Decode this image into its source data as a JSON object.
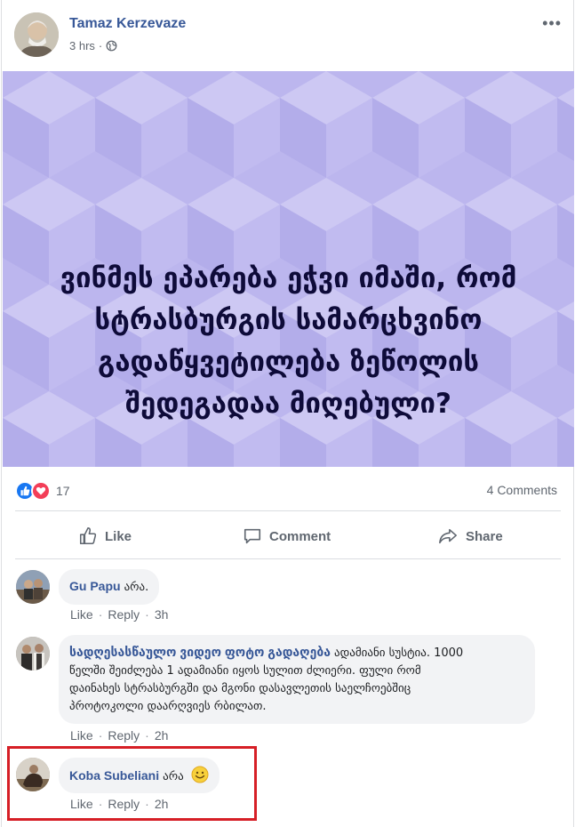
{
  "post": {
    "author": "Tamaz Kerzevaze",
    "time": "3 hrs",
    "privacy_icon": "globe-icon",
    "more_label": "•••",
    "image_text_lines": [
      "ვინმეს ეპარება ეჭვი იმაში, რომ",
      "სტრასბურგის სამარცხვინო",
      "გადაწყვეტილება ზეწოლის",
      "შედეგადაა მიღებული?"
    ],
    "image_bg_color": "#bcb6ee"
  },
  "reactions": {
    "count": "17",
    "comments": "4 Comments",
    "like_color": "#1877f2",
    "love_color": "#f33e58"
  },
  "actions": {
    "like": "Like",
    "comment": "Comment",
    "share": "Share"
  },
  "comments": [
    {
      "name": "Gu Papu",
      "text": "არა.",
      "like": "Like",
      "reply": "Reply",
      "time": "3h"
    },
    {
      "name": "სადღესასწაულო ვიდეო ფოტო გადაღება",
      "text_lines": [
        "ადამიანი სუსტია. 1000",
        "წელში შეიძლება 1 ადამიანი იყოს სულით ძლიერი. ფული რომ",
        "დაინახეს სტრასბურგში და მგონი დასავლეთის საელჩოებშიც",
        "პროტოკოლი დაარღვიეს რბილათ."
      ],
      "like": "Like",
      "reply": "Reply",
      "time": "2h"
    },
    {
      "name": "Koba Subeliani",
      "text": "არა",
      "emoji": "smiley-icon",
      "like": "Like",
      "reply": "Reply",
      "time": "2h"
    }
  ],
  "highlight_color": "#d61f26"
}
